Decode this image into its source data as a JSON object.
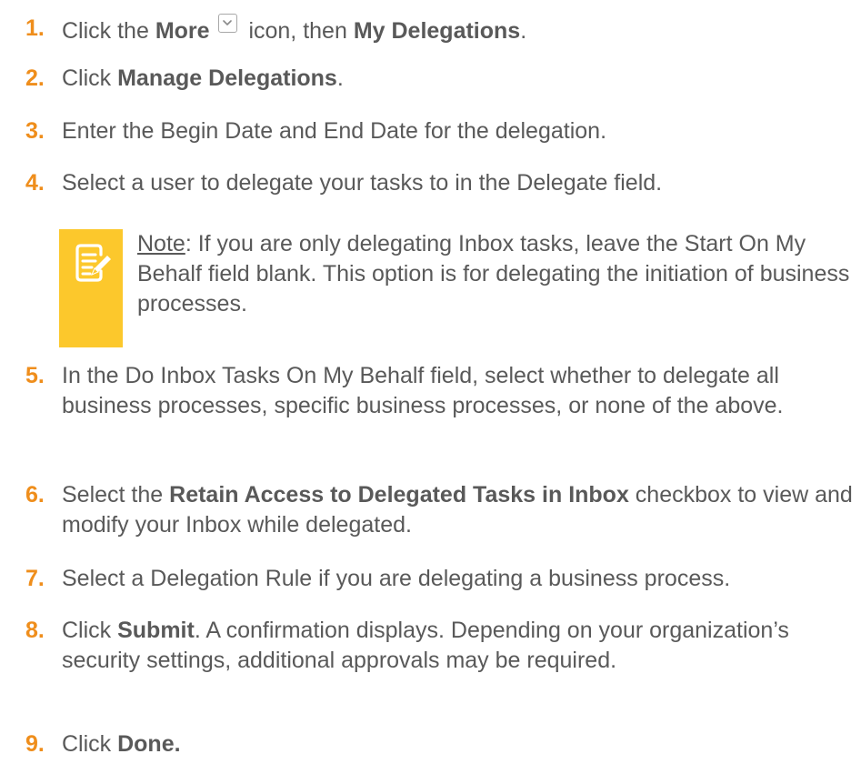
{
  "steps": [
    {
      "num": "1.",
      "pre": "Click the ",
      "b1": "More",
      "mid": " icon, then ",
      "b2": "My Delegations",
      "post": "."
    },
    {
      "num": "2.",
      "pre": "Click ",
      "b1": "Manage Delegations",
      "post": "."
    },
    {
      "num": "3.",
      "text": "Enter the Begin Date and End Date for the delegation."
    },
    {
      "num": "4.",
      "text": "Select a user to delegate your tasks to in the Delegate field."
    },
    {
      "num": "5.",
      "text": "In the Do Inbox Tasks On My Behalf field, select whether to delegate all business processes, specific business processes, or none of the above."
    },
    {
      "num": "6.",
      "pre": "Select the ",
      "b1": "Retain Access to Delegated Tasks in Inbox",
      "post": " checkbox to view and modify your Inbox while delegated."
    },
    {
      "num": "7.",
      "text": "Select a Delegation Rule if you are delegating a business process."
    },
    {
      "num": "8.",
      "pre": "Click ",
      "b1": "Submit",
      "post": ". A confirmation displays. Depending on your organization’s security settings, additional approvals may be required."
    },
    {
      "num": "9.",
      "pre": "Click ",
      "b1": "Done."
    }
  ],
  "note": {
    "label": "Note",
    "text": ": If you are only delegating Inbox tasks, leave the Start On My Behalf field blank. This option is for delegating the initiation of business processes."
  },
  "icons": {
    "more": "chevron-down-icon",
    "note": "note-pencil-icon"
  },
  "colors": {
    "step_number": "#ef8e1c",
    "body_text": "#595959",
    "note_box": "#fcc82c"
  }
}
